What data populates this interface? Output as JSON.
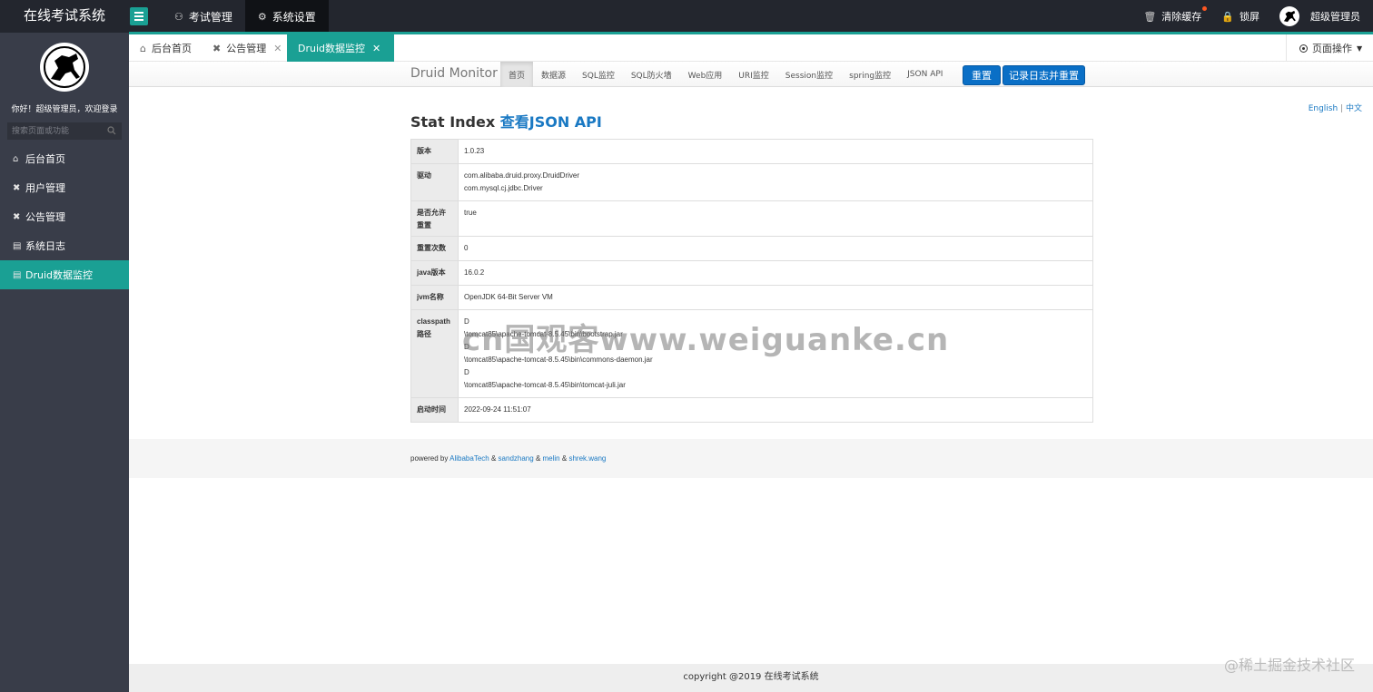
{
  "app": {
    "title": "在线考试系统"
  },
  "top_nav": [
    {
      "label": "考试管理",
      "icon": "users-icon",
      "active": false
    },
    {
      "label": "系统设置",
      "icon": "gear-icon",
      "active": true
    }
  ],
  "top_right": {
    "clear_cache": "清除缓存",
    "lock_screen": "锁屏",
    "user_name": "超级管理员"
  },
  "sidebar": {
    "welcome": "你好！超级管理员，欢迎登录",
    "search_placeholder": "搜索页面或功能",
    "items": [
      {
        "label": "后台首页",
        "icon": "home-icon",
        "active": false
      },
      {
        "label": "用户管理",
        "icon": "tools-icon",
        "active": false
      },
      {
        "label": "公告管理",
        "icon": "tools-icon",
        "active": false
      },
      {
        "label": "系统日志",
        "icon": "doc-icon",
        "active": false
      },
      {
        "label": "Druid数据监控",
        "icon": "doc-icon",
        "active": true
      }
    ]
  },
  "tabs": [
    {
      "label": "后台首页",
      "icon": "home-icon",
      "closable": false,
      "active": false
    },
    {
      "label": "公告管理",
      "icon": "tools-icon",
      "closable": true,
      "active": false
    },
    {
      "label": "Druid数据监控",
      "icon": "doc-icon",
      "closable": true,
      "active": true
    }
  ],
  "page_ops": "页面操作",
  "druid": {
    "brand": "Druid Monitor",
    "nav": [
      "首页",
      "数据源",
      "SQL监控",
      "SQL防火墙",
      "Web应用",
      "URI监控",
      "Session监控",
      "spring监控",
      "JSON API"
    ],
    "reset_label": "重置",
    "log_reset_label": "记录日志并重置",
    "lang_en": "English",
    "lang_sep": "|",
    "lang_zh": "中文",
    "stat_title": "Stat Index",
    "stat_json_link": "查看JSON API",
    "rows": {
      "version_key": "版本",
      "version_val": "1.0.23",
      "driver_key": "驱动",
      "driver_val_1": "com.alibaba.druid.proxy.DruidDriver",
      "driver_val_2": "com.mysql.cj.jdbc.Driver",
      "reset_allowed_key": "是否允许重置",
      "reset_allowed_val": "true",
      "reset_count_key": "重置次数",
      "reset_count_val": "0",
      "java_key": "java版本",
      "java_val": "16.0.2",
      "jvm_key": "jvm名称",
      "jvm_val": "OpenJDK 64-Bit Server VM",
      "classpath_key": "classpath路径",
      "cp_1": "D",
      "cp_2": "\\tomcat85\\apache-tomcat-8.5.45\\bin\\bootstrap.jar",
      "cp_3": "D",
      "cp_4": "\\tomcat85\\apache-tomcat-8.5.45\\bin\\commons-daemon.jar",
      "cp_5": "D",
      "cp_6": "\\tomcat85\\apache-tomcat-8.5.45\\bin\\tomcat-juli.jar",
      "start_key": "启动时间",
      "start_val": "2022-09-24 11:51:07"
    },
    "powered_by": "powered by",
    "author_1": "AlibabaTech",
    "author_2": "sandzhang",
    "author_3": "melin",
    "author_4": "shrek.wang",
    "amp": "&"
  },
  "copyright": "copyright @2019 在线考试系统",
  "watermark": "cn国观客www.weiguanke.cn",
  "corner_mark": "@稀土掘金技术社区",
  "colors": {
    "accent": "#1aa094",
    "header": "#23262e",
    "sidebar": "#393d49",
    "link": "#1a79c3",
    "druid_button": "#0a6fc6"
  }
}
